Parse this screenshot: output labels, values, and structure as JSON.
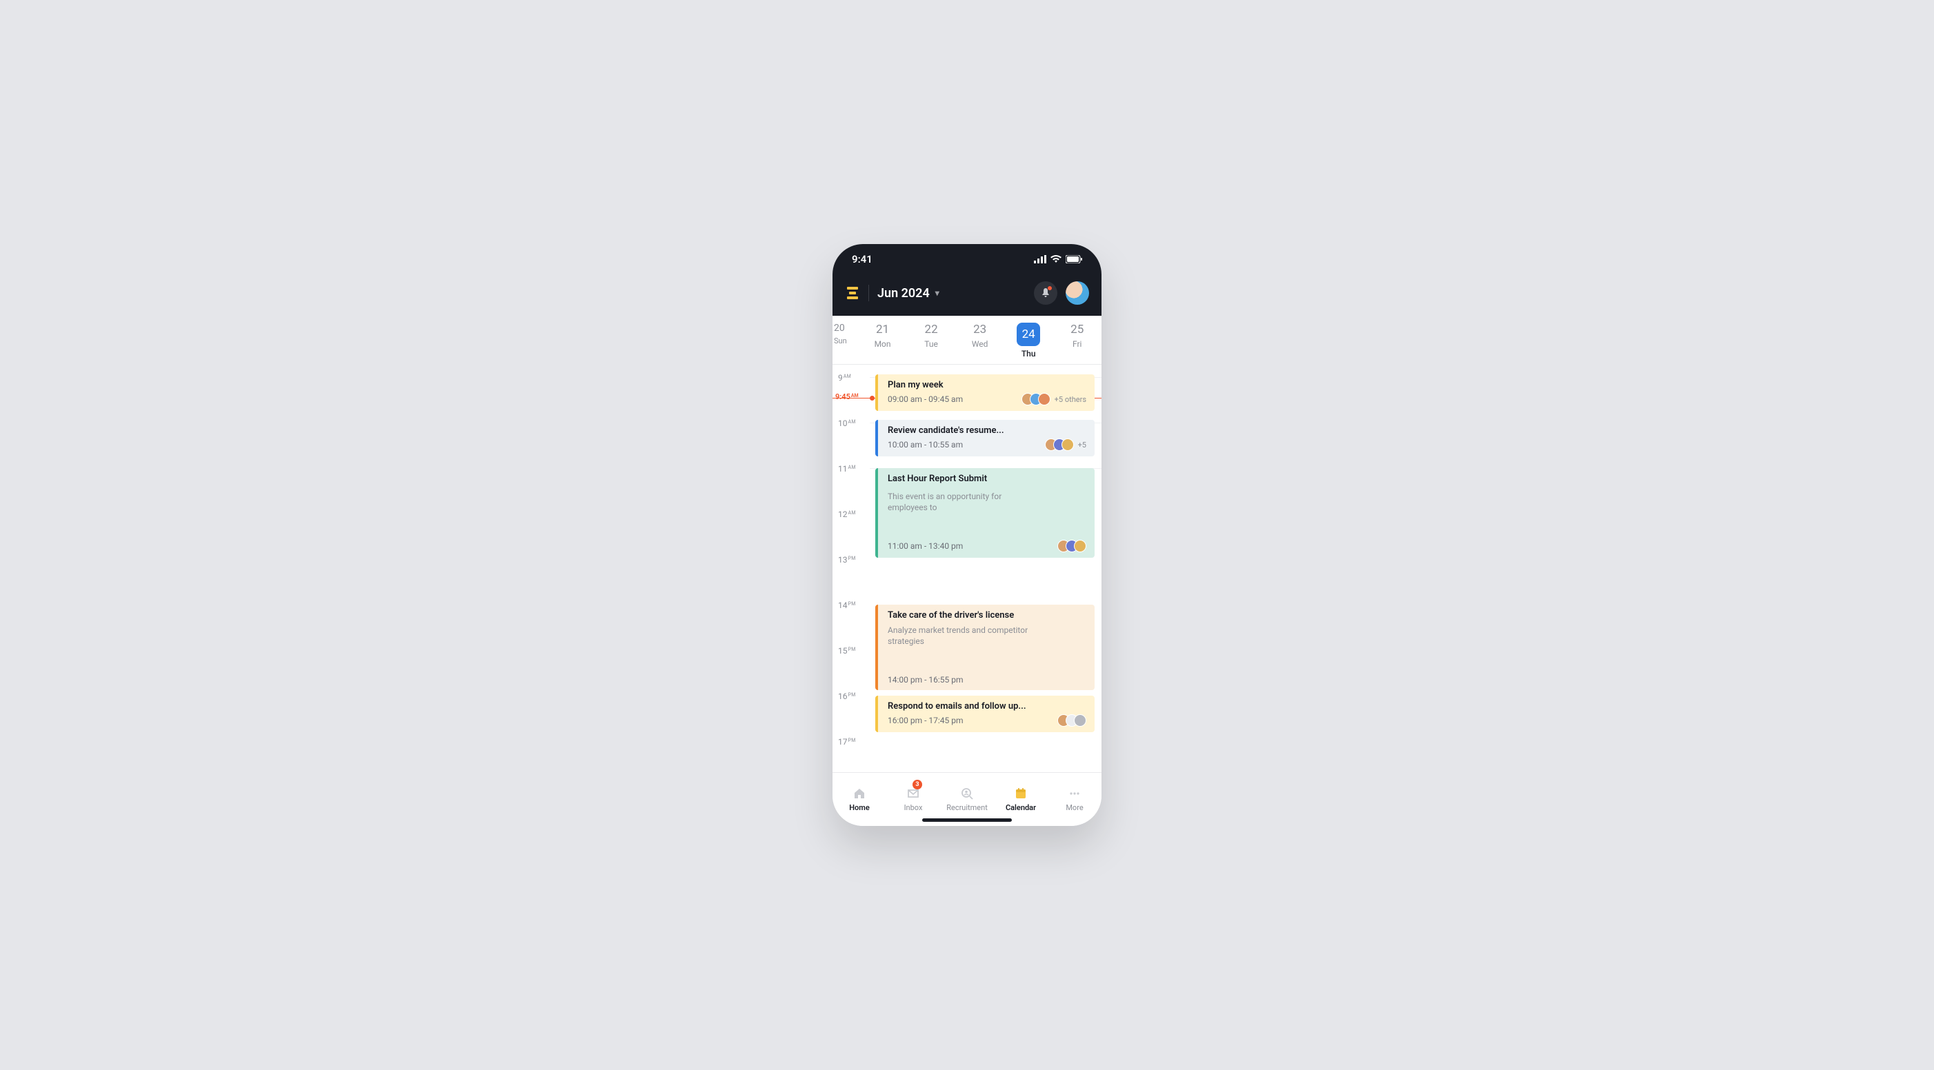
{
  "status": {
    "time": "9:41"
  },
  "header": {
    "month": "Jun 2024"
  },
  "week": [
    {
      "num": "20",
      "lbl": "Sun"
    },
    {
      "num": "21",
      "lbl": "Mon"
    },
    {
      "num": "22",
      "lbl": "Tue"
    },
    {
      "num": "23",
      "lbl": "Wed"
    },
    {
      "num": "24",
      "lbl": "Thu",
      "selected": true
    },
    {
      "num": "25",
      "lbl": "Fri"
    }
  ],
  "now": {
    "label": "9:45",
    "unit": "AM"
  },
  "hours": [
    {
      "n": "9",
      "u": "AM"
    },
    {
      "n": "10",
      "u": "AM"
    },
    {
      "n": "11",
      "u": "AM"
    },
    {
      "n": "12",
      "u": "AM"
    },
    {
      "n": "13",
      "u": "PM"
    },
    {
      "n": "14",
      "u": "PM"
    },
    {
      "n": "15",
      "u": "PM"
    },
    {
      "n": "16",
      "u": "PM"
    },
    {
      "n": "17",
      "u": "PM"
    }
  ],
  "events": [
    {
      "title": "Plan my week",
      "time": "09:00 am - 09:45 am",
      "overflow": "+5 others",
      "bg": "#fff3d2",
      "accent": "#f6c443"
    },
    {
      "title": "Review candidate's resume...",
      "time": "10:00 am - 10:55 am",
      "overflow": "+5",
      "bg": "#eef2f5",
      "accent": "#2f7de1"
    },
    {
      "title": "Last Hour Report Submit",
      "desc": "This event is an opportunity for employees to",
      "time": "11:00 am - 13:40 pm",
      "bg": "#d7eee6",
      "accent": "#3fb490"
    },
    {
      "title": "Take care of the driver's license",
      "desc": "Analyze market trends and competitor strategies",
      "time": "14:00 pm - 16:55 pm",
      "bg": "#fbeedd",
      "accent": "#f0852c"
    },
    {
      "title": "Respond to emails and follow up...",
      "time": "16:00 pm - 17:45 pm",
      "bg": "#fff3d2",
      "accent": "#f6c443"
    }
  ],
  "nav": {
    "home": "Home",
    "inbox": "Inbox",
    "inbox_badge": "3",
    "recruitment": "Recruitment",
    "calendar": "Calendar",
    "more": "More"
  }
}
